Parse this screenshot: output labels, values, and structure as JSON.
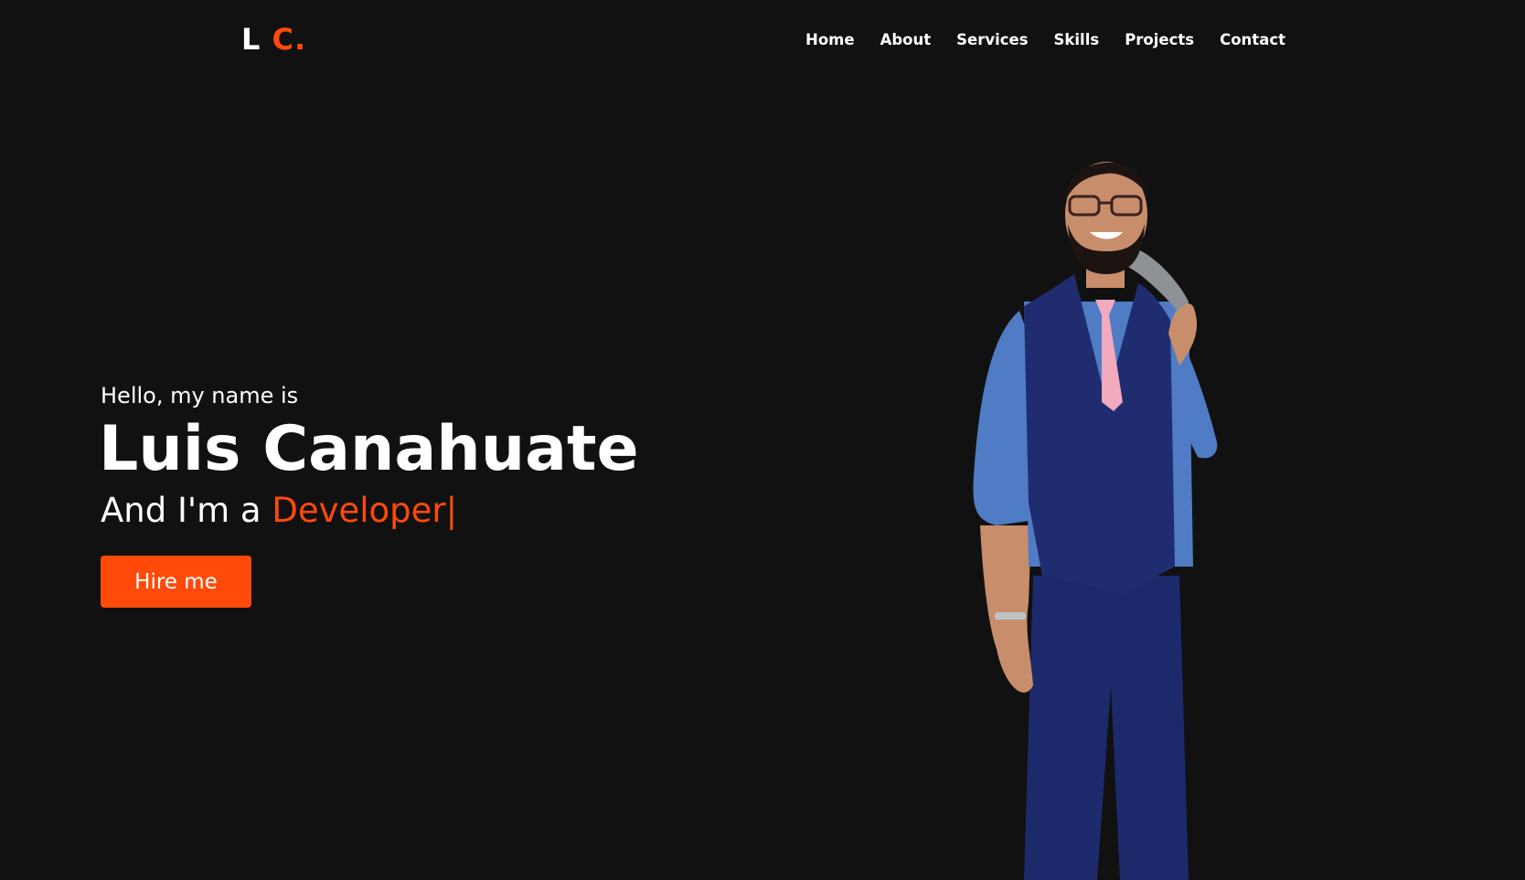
{
  "navbar": {
    "logo_main": "L",
    "logo_accent": "C.",
    "items": [
      {
        "label": "Home"
      },
      {
        "label": "About"
      },
      {
        "label": "Services"
      },
      {
        "label": "Skills"
      },
      {
        "label": "Projects"
      },
      {
        "label": "Contact"
      }
    ]
  },
  "hero": {
    "greeting": "Hello, my name is",
    "name": "Luis Canahuate",
    "role_prefix": "And I'm a",
    "role_typed": "Developer|",
    "cta_label": "Hire me"
  },
  "colors": {
    "background": "#111111",
    "accent": "#ff4a0a",
    "text": "#ffffff"
  }
}
